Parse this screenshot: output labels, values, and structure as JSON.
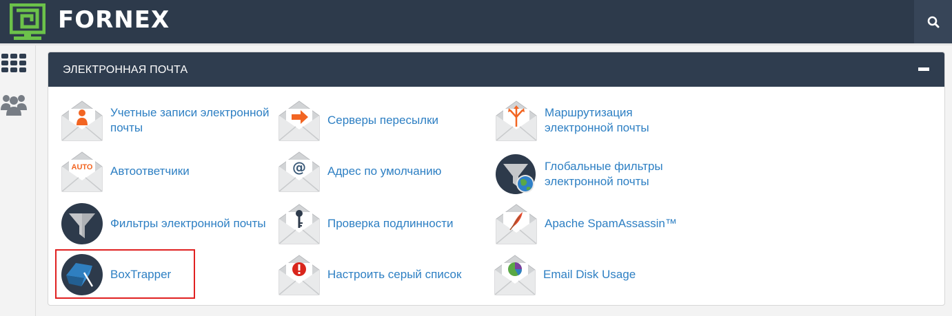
{
  "brand": {
    "name": "FORNEX",
    "logo_color": "#6cc24a"
  },
  "topbar": {
    "search_icon": "search-icon"
  },
  "leftnav": {
    "items": [
      {
        "icon": "grid-icon"
      },
      {
        "icon": "users-icon"
      }
    ]
  },
  "panel": {
    "title": "ЭЛЕКТРОННАЯ ПОЧТА",
    "collapse_icon": "minus-icon",
    "items": [
      {
        "label": "Учетные записи электронной\nпочты",
        "icon": "envelope-user-icon"
      },
      {
        "label": "Серверы пересылки",
        "icon": "envelope-arrow-icon"
      },
      {
        "label": "Маршрутизация\nэлектронной почты",
        "icon": "envelope-routing-icon"
      },
      {
        "label": "Автоответчики",
        "icon": "envelope-auto-icon"
      },
      {
        "label": "Адрес по умолчанию",
        "icon": "envelope-at-icon"
      },
      {
        "label": "Глобальные фильтры\nэлектронной почты",
        "icon": "global-filter-icon"
      },
      {
        "label": "Фильтры электронной почты",
        "icon": "filter-icon"
      },
      {
        "label": "Проверка подлинности",
        "icon": "envelope-key-icon"
      },
      {
        "label": "Apache SpamAssassin™",
        "icon": "envelope-feather-icon"
      },
      {
        "label": "BoxTrapper",
        "icon": "boxtrapper-icon"
      },
      {
        "label": "Настроить серый список",
        "icon": "envelope-alert-icon"
      },
      {
        "label": "Email Disk Usage",
        "icon": "envelope-pie-icon"
      }
    ]
  },
  "colors": {
    "link": "#2d7fc3",
    "header": "#2f3d4f",
    "topbar": "#2d3a4b",
    "highlight": "#e02020",
    "accent": "#f26522"
  }
}
